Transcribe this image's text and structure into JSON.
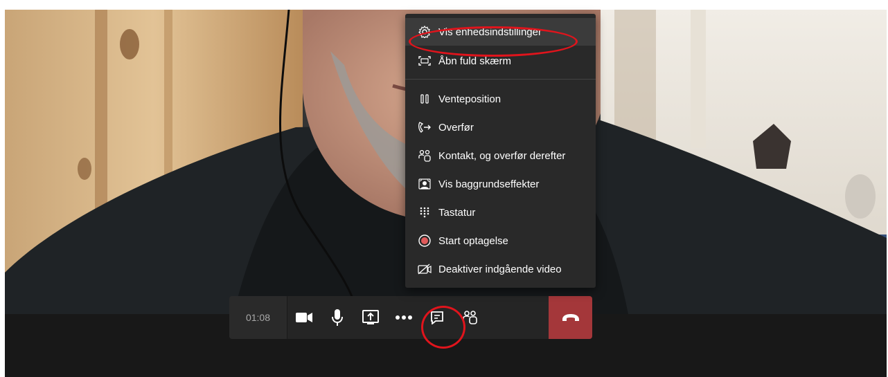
{
  "call": {
    "timer": "01:08"
  },
  "menu": {
    "items": [
      {
        "label": "Vis enhedsindstillinger",
        "icon": "gear-icon"
      },
      {
        "label": "Åbn fuld skærm",
        "icon": "fullscreen-icon"
      },
      {
        "label": "Venteposition",
        "icon": "pause-icon"
      },
      {
        "label": "Overfør",
        "icon": "transfer-icon"
      },
      {
        "label": "Kontakt, og overfør derefter",
        "icon": "consult-icon"
      },
      {
        "label": "Vis baggrundseffekter",
        "icon": "background-effects-icon"
      },
      {
        "label": "Tastatur",
        "icon": "dialpad-icon"
      },
      {
        "label": "Start optagelse",
        "icon": "record-icon"
      },
      {
        "label": "Deaktiver indgående video",
        "icon": "video-off-icon"
      }
    ]
  },
  "toolbar": {
    "buttons": [
      "camera-icon",
      "microphone-icon",
      "share-screen-icon",
      "more-icon",
      "chat-icon",
      "participants-icon",
      "hang-up-icon"
    ]
  },
  "colors": {
    "hang_up": "#a4373a",
    "annotation": "#e0141c",
    "record": "#e05a5a"
  }
}
